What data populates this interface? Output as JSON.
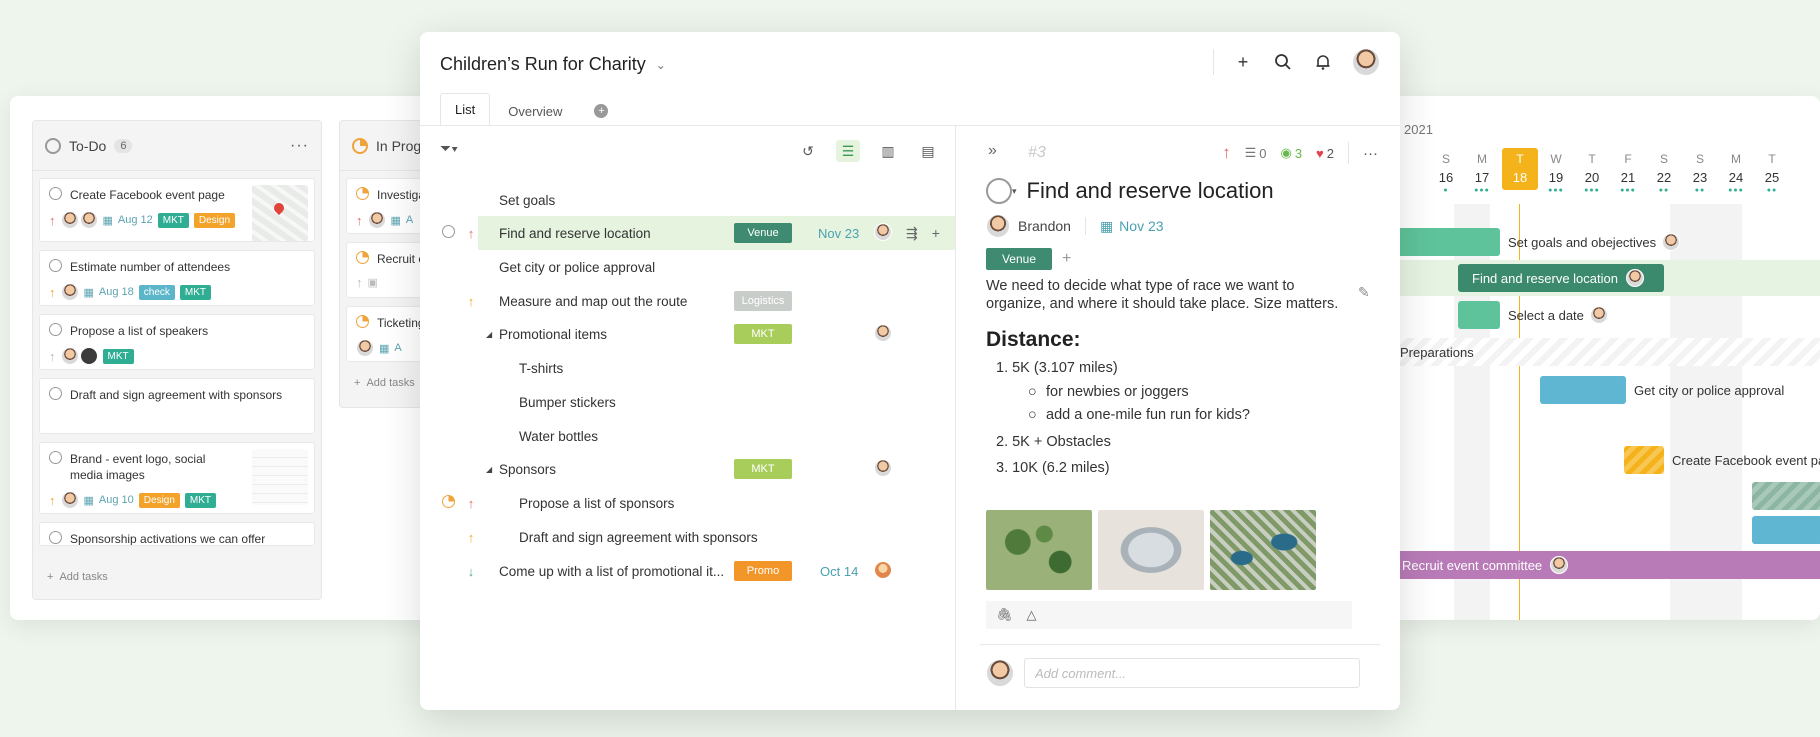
{
  "kanban": {
    "col1": {
      "title": "To-Do",
      "count": "6",
      "more": "···"
    },
    "col2": {
      "title": "In Progr"
    },
    "cards": [
      {
        "title": "Create Facebook event page",
        "date": "Aug 12",
        "tags": [
          "MKT",
          "Design"
        ]
      },
      {
        "title": "Estimate number of attendees",
        "date": "Aug 18",
        "tags": [
          "check",
          "MKT"
        ]
      },
      {
        "title": "Propose a list of speakers",
        "tags": [
          "MKT"
        ]
      },
      {
        "title": "Draft and sign agreement with sponsors"
      },
      {
        "title": "Brand - event logo, social media images",
        "date": "Aug 10",
        "tags": [
          "Design",
          "MKT"
        ]
      },
      {
        "title": "Sponsorship activations we can offer"
      }
    ],
    "col2_cards": [
      "Investigat",
      "Recruit ev",
      "Ticketing"
    ],
    "col2_meta": [
      "A"
    ],
    "add_tasks": "Add tasks",
    "add_tasks_short": "Add tasks"
  },
  "gantt": {
    "year": "2021",
    "days": [
      {
        "l": "S",
        "n": "16"
      },
      {
        "l": "M",
        "n": "17"
      },
      {
        "l": "T",
        "n": "18"
      },
      {
        "l": "W",
        "n": "19"
      },
      {
        "l": "T",
        "n": "20"
      },
      {
        "l": "F",
        "n": "21"
      },
      {
        "l": "S",
        "n": "22"
      },
      {
        "l": "S",
        "n": "23"
      },
      {
        "l": "M",
        "n": "24"
      },
      {
        "l": "T",
        "n": "25"
      }
    ],
    "bars": [
      "Set goals and obejectives",
      "Find and reserve location",
      "Select a date",
      "Preparations",
      "Get city or police approval",
      "Create Facebook event pa",
      "Recruit event committee"
    ]
  },
  "main": {
    "project_title": "Children’s Run for Charity",
    "tabs": [
      "List",
      "Overview"
    ],
    "rows": [
      {
        "name": "Set goals"
      },
      {
        "name": "Find and reserve location",
        "tag": "Venue",
        "date": "Nov 23"
      },
      {
        "name": "Get city or police approval"
      },
      {
        "name": "Measure and map out the route",
        "tag": "Logistics"
      },
      {
        "name": "Promotional items",
        "tag": "MKT"
      },
      {
        "name": "T-shirts"
      },
      {
        "name": "Bumper stickers"
      },
      {
        "name": "Water bottles"
      },
      {
        "name": "Sponsors",
        "tag": "MKT"
      },
      {
        "name": "Propose a list of sponsors"
      },
      {
        "name": "Draft and sign agreement with sponsors"
      },
      {
        "name": "Come up with a list of promotional it...",
        "tag": "Promo",
        "date": "Oct 14"
      }
    ]
  },
  "detail": {
    "task_number": "#3",
    "comments_count": "0",
    "watchers_count": "3",
    "likes_count": "2",
    "title": "Find and reserve location",
    "assignee": "Brandon",
    "due": "Nov 23",
    "tag": "Venue",
    "description": "We need to decide what type of race we want to organize, and where it should take place. Size matters.",
    "heading": "Distance:",
    "list": [
      "1. 5K (3.107 miles)",
      "for newbies or joggers",
      "add a one-mile fun run for kids?",
      "2. 5K + Obstacles",
      "3. 10K (6.2 miles)"
    ],
    "comment_placeholder": "Add comment..."
  },
  "colors": {
    "accent_green": "#3e8b72",
    "highlight": "#e5f3df",
    "today": "#f5b31b",
    "mkt": "#a9cd5b",
    "promo": "#f3962a"
  }
}
